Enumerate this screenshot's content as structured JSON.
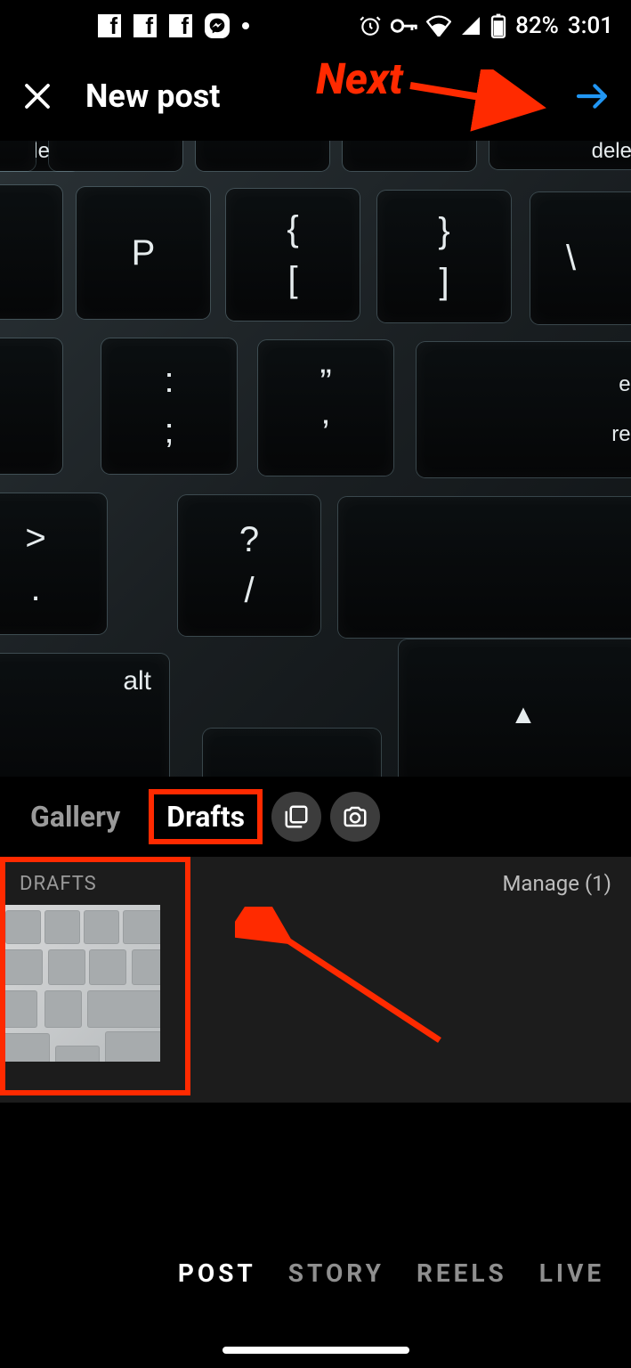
{
  "status": {
    "battery_percent": "82%",
    "time": "3:01"
  },
  "header": {
    "title": "New post"
  },
  "annotation": {
    "next_label": "Next"
  },
  "tabs": {
    "gallery": "Gallery",
    "drafts": "Drafts"
  },
  "drafts": {
    "section_label": "DRAFTS",
    "manage_label": "Manage (1)"
  },
  "modes": {
    "post": "POST",
    "story": "STORY",
    "reels": "REELS",
    "live": "LIVE"
  },
  "preview_keys": {
    "p": "P",
    "brace_open_top": "{",
    "brace_open_bot": "[",
    "brace_close_top": "}",
    "brace_close_bot": "]",
    "backslash": "\\",
    "delete": "delete",
    "colon_top": ":",
    "colon_bot": ";",
    "quote_top": "”",
    "quote_bot": "’",
    "enter_top": "enter",
    "enter_bot": "return",
    "angle_top": ">",
    "angle_bot": ".",
    "question_top": "?",
    "question_bot": "/",
    "alt": "alt",
    "arrow_up": "▲"
  }
}
